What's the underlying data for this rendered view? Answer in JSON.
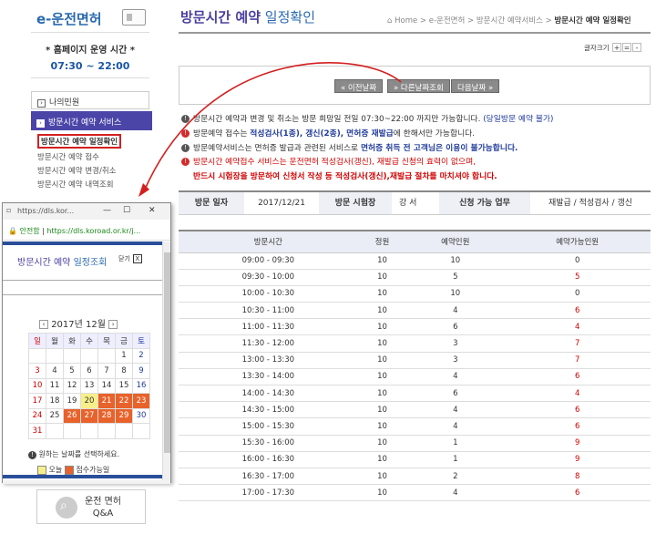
{
  "sidebar": {
    "logo_text": "e-운전면허",
    "hours_label": "* 홈페이지 운영 시간 *",
    "hours_value": "07:30 ~ 22:00",
    "my_civil": "나의민원",
    "visit_service": "방문시간 예약 서비스",
    "sub_items": [
      "방문시간 예약 일정확인",
      "방문시간 예약 접수",
      "방문시간 예약 변경/취소",
      "방문시간 예약 내역조회"
    ],
    "qa_label": "운전 면허\nQ&A"
  },
  "header": {
    "title_main": "방문시간 예약",
    "title_rest": " 일정확인",
    "breadcrumb": [
      "Home",
      "e-운전면허",
      "방문시간 예약서비스",
      "방문시간 예약 일정확인"
    ],
    "font_size_label": "글자크기",
    "font_btns": [
      "+",
      "=",
      "-"
    ]
  },
  "buttons": {
    "prev": "« 이전날짜",
    "date_lookup": "» 다른날짜조회",
    "next": "다음날짜 »"
  },
  "notes": [
    {
      "a": "방문시간 예약과 변경 및 취소는 방문 희망일 전일 07:30~22:00 까지만 가능합니다.",
      "b": "(당일방문 예약 불가)"
    },
    {
      "a": "방문예약 접수는 ",
      "b": "적성검사(1종), 갱신(2종), 면허증 재발급",
      "c": "에 한해서만 가능합니다."
    },
    {
      "a": "방문예약서비스는 면허증 발급과 관련된 서비스로 ",
      "b": "면허증 취득 전 고객님은 이용이 불가능합니다."
    },
    {
      "a": "방문시간 예약접수 서비스는 운전면허 적성검사(갱신), 재발급 신청의 효력이 없으며,"
    },
    {
      "a": "반드시 시험장을 방문하여 신청서 작성 등 적성검사(갱신),재발급 절차를 마치셔야 합니다."
    }
  ],
  "info": {
    "date_label": "방문 일자",
    "date_value": "2017/12/21",
    "site_label": "방문 시험장",
    "site_value": "강 서",
    "task_label": "신청 가능 업무",
    "task_value": "재발급 / 적성검사 / 갱신"
  },
  "table": {
    "headers": [
      "방문시간",
      "정원",
      "예약인원",
      "예약가능인원"
    ],
    "rows": [
      [
        "09:00 - 09:30",
        "10",
        "10",
        "0"
      ],
      [
        "09:30 - 10:00",
        "10",
        "5",
        "5"
      ],
      [
        "10:00 - 10:30",
        "10",
        "10",
        "0"
      ],
      [
        "10:30 - 11:00",
        "10",
        "4",
        "6"
      ],
      [
        "11:00 - 11:30",
        "10",
        "6",
        "4"
      ],
      [
        "11:30 - 12:00",
        "10",
        "3",
        "7"
      ],
      [
        "13:00 - 13:30",
        "10",
        "3",
        "7"
      ],
      [
        "13:30 - 14:00",
        "10",
        "4",
        "6"
      ],
      [
        "14:00 - 14:30",
        "10",
        "6",
        "4"
      ],
      [
        "14:30 - 15:00",
        "10",
        "4",
        "6"
      ],
      [
        "15:00 - 15:30",
        "10",
        "4",
        "6"
      ],
      [
        "15:30 - 16:00",
        "10",
        "1",
        "9"
      ],
      [
        "16:00 - 16:30",
        "10",
        "1",
        "9"
      ],
      [
        "16:30 - 17:00",
        "10",
        "2",
        "8"
      ],
      [
        "17:00 - 17:30",
        "10",
        "4",
        "6"
      ]
    ]
  },
  "popup": {
    "window_url": "https://dls.kor...",
    "secure_label": "안전함",
    "address": "https://dls.koroad.or.kr/j...",
    "title_main": "방문시간 예약",
    "title_rest": " 일정조회",
    "close_label": "닫기",
    "close_x": "X",
    "month_label": "2017년 12월",
    "weekdays": [
      "일",
      "월",
      "화",
      "수",
      "목",
      "금",
      "토"
    ],
    "weeks": [
      [
        "",
        "",
        "",
        "",
        "",
        "1",
        "2"
      ],
      [
        "3",
        "4",
        "5",
        "6",
        "7",
        "8",
        "9"
      ],
      [
        "10",
        "11",
        "12",
        "13",
        "14",
        "15",
        "16"
      ],
      [
        "17",
        "18",
        "19",
        "20",
        "21",
        "22",
        "23"
      ],
      [
        "24",
        "25",
        "26",
        "27",
        "28",
        "29",
        "30"
      ],
      [
        "31",
        "",
        "",
        "",
        "",
        "",
        ""
      ]
    ],
    "today": "20",
    "available": [
      "21",
      "22",
      "23",
      "26",
      "27",
      "28",
      "29"
    ],
    "help": "원하는 날짜를 선택하세요.",
    "legend_today": "오늘",
    "legend_avail": "접수가능일",
    "colors": {
      "today": "#f7f08a",
      "available": "#e8622b"
    }
  }
}
